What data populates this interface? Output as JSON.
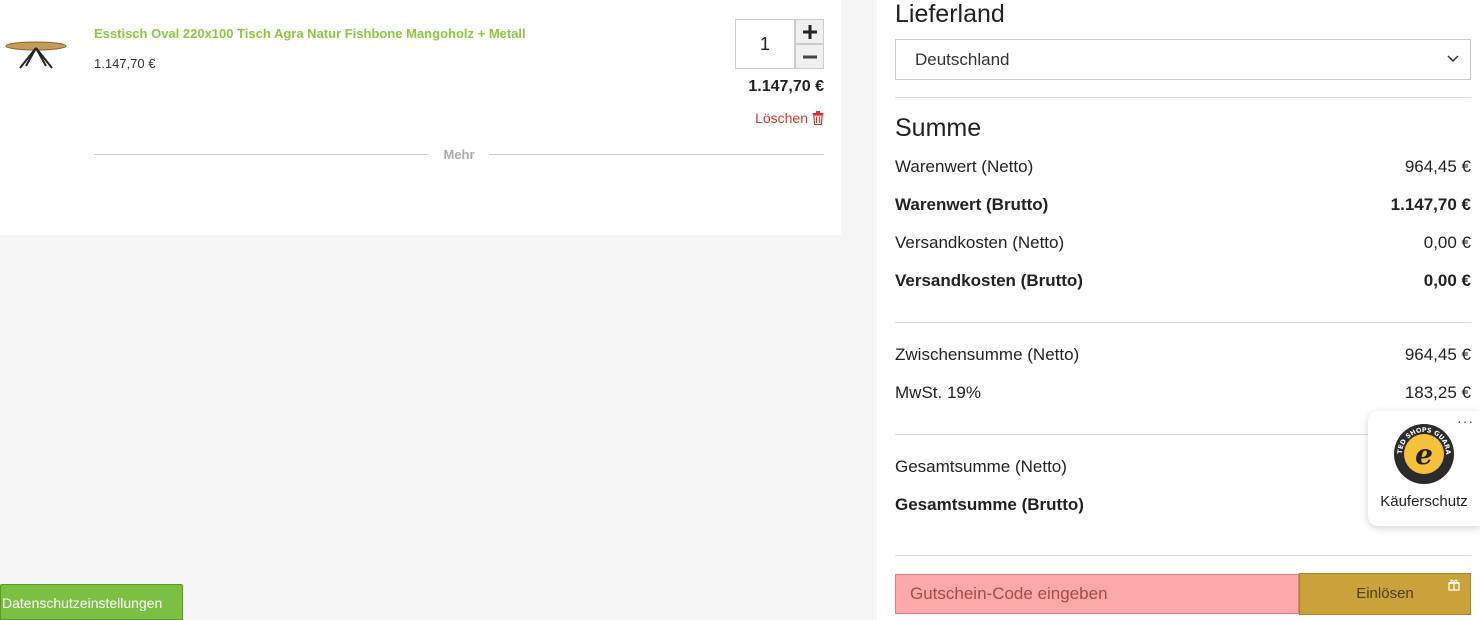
{
  "cart": {
    "product": {
      "title": "Esstisch Oval 220x100 Tisch Agra Natur Fishbone Mangoholz + Metall",
      "unit_price": "1.147,70 €",
      "quantity": "1",
      "line_total": "1.147,70 €",
      "delete_label": "Löschen",
      "image_icon": "table-thumbnail"
    },
    "more_label": "Mehr"
  },
  "summary": {
    "country_heading": "Lieferland",
    "country_selected": "Deutschland",
    "sum_heading": "Summe",
    "rows_group1": [
      {
        "label": "Warenwert (Netto)",
        "value": "964,45 €"
      },
      {
        "label": "Warenwert (Brutto)",
        "value": "1.147,70 €"
      },
      {
        "label": "Versandkosten (Netto)",
        "value": "0,00 €"
      },
      {
        "label": "Versandkosten (Brutto)",
        "value": "0,00 €"
      }
    ],
    "rows_group2": [
      {
        "label": "Zwischensumme (Netto)",
        "value": "964,45 €"
      },
      {
        "label": "MwSt. 19%",
        "value": "183,25 €"
      }
    ],
    "rows_group3": [
      {
        "label": "Gesamtsumme (Netto)",
        "value": ""
      },
      {
        "label": "Gesamtsumme (Brutto)",
        "value": ""
      }
    ],
    "coupon_placeholder": "Gutschein-Code eingeben",
    "redeem_label": "Einlösen"
  },
  "trust_badge": {
    "label": "Käuferschutz",
    "more": "···",
    "seal_letter": "e",
    "seal_text": "TRUSTED SHOPS GUARANTEE"
  },
  "privacy_button": "Datenschutzeinstellungen",
  "colors": {
    "product_link": "#8dc63f",
    "delete": "#d9342b",
    "coupon_bg": "#ffaaaa",
    "redeem_bg": "#c9a23a",
    "privacy_bg": "#7cc043"
  }
}
